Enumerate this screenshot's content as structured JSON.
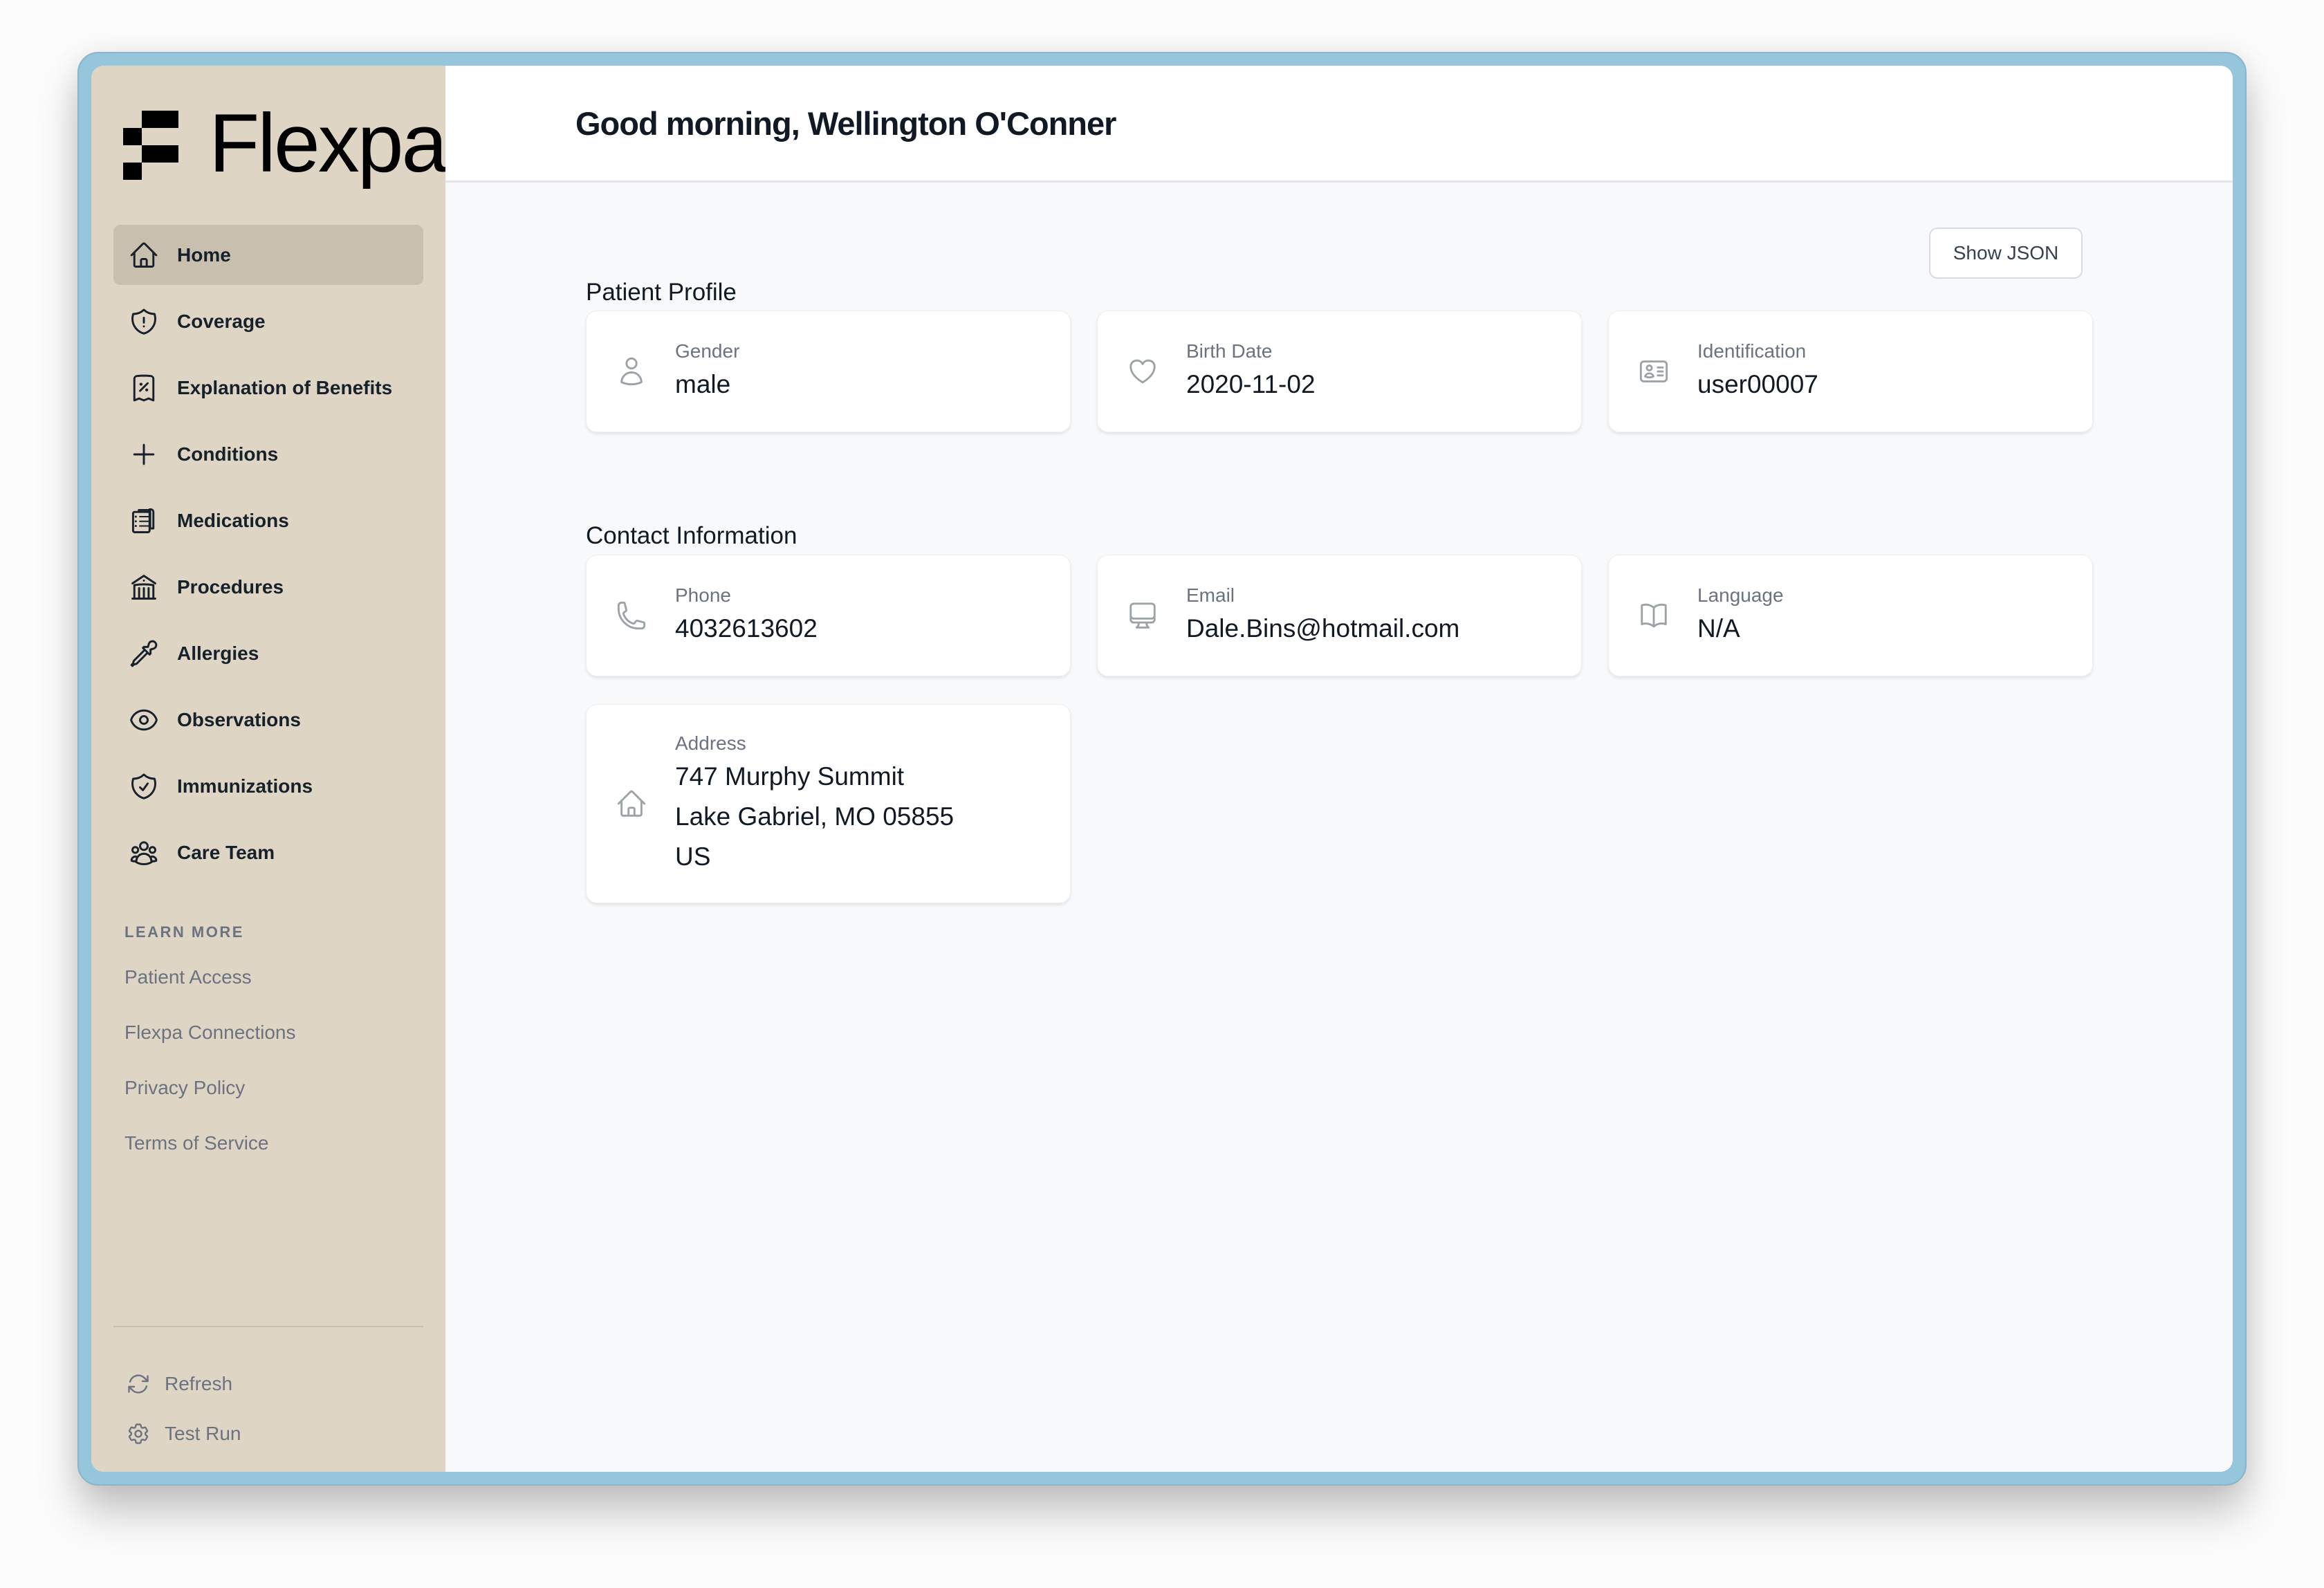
{
  "app": {
    "brand": "Flexpa"
  },
  "sidebar": {
    "items": [
      {
        "label": "Home",
        "icon": "home-icon",
        "active": true
      },
      {
        "label": "Coverage",
        "icon": "shield-exclamation-icon",
        "active": false
      },
      {
        "label": "Explanation of Benefits",
        "icon": "receipt-percent-icon",
        "active": false
      },
      {
        "label": "Conditions",
        "icon": "plus-icon",
        "active": false
      },
      {
        "label": "Medications",
        "icon": "clipboard-document-list-icon",
        "active": false
      },
      {
        "label": "Procedures",
        "icon": "building-library-icon",
        "active": false
      },
      {
        "label": "Allergies",
        "icon": "eyedropper-icon",
        "active": false
      },
      {
        "label": "Observations",
        "icon": "eye-icon",
        "active": false
      },
      {
        "label": "Immunizations",
        "icon": "shield-check-icon",
        "active": false
      },
      {
        "label": "Care Team",
        "icon": "user-group-icon",
        "active": false
      }
    ],
    "learn_more": {
      "heading": "LEARN MORE",
      "links": [
        "Patient Access",
        "Flexpa Connections",
        "Privacy Policy",
        "Terms of Service"
      ]
    },
    "footer": {
      "refresh_label": "Refresh",
      "test_run_label": "Test Run"
    }
  },
  "header": {
    "greeting": "Good morning, Wellington O'Conner"
  },
  "main": {
    "show_json_label": "Show JSON",
    "patient_profile": {
      "title": "Patient Profile",
      "cards": [
        {
          "label": "Gender",
          "value": "male",
          "icon": "user-icon"
        },
        {
          "label": "Birth Date",
          "value": "2020-11-02",
          "icon": "heart-icon"
        },
        {
          "label": "Identification",
          "value": "user00007",
          "icon": "identification-icon"
        }
      ]
    },
    "contact_information": {
      "title": "Contact Information",
      "cards": [
        {
          "label": "Phone",
          "value": "4032613602",
          "icon": "phone-icon"
        },
        {
          "label": "Email",
          "value": "Dale.Bins@hotmail.com",
          "icon": "computer-desktop-icon"
        },
        {
          "label": "Language",
          "value": "N/A",
          "icon": "book-open-icon"
        }
      ],
      "address": {
        "label": "Address",
        "lines": [
          "747 Murphy Summit",
          "Lake Gabriel, MO 05855",
          "US"
        ],
        "icon": "home-icon"
      }
    }
  },
  "colors": {
    "frame": "#96c6dc",
    "sidebar_bg": "#ded5c4",
    "sidebar_active": "#c8bfaf",
    "content_bg": "#f8f9fa",
    "text_primary": "#111a24",
    "text_muted": "#6b7280"
  }
}
